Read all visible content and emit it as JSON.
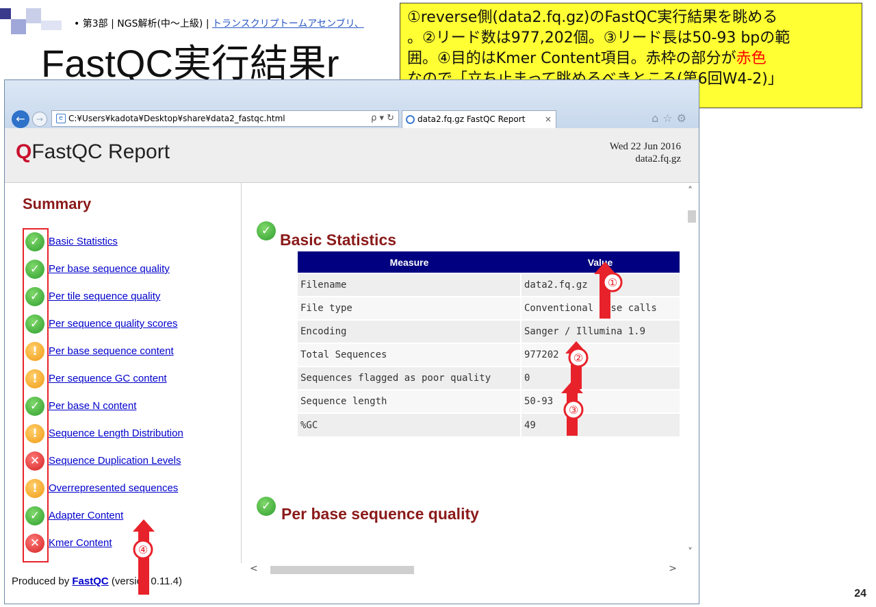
{
  "slide": {
    "bullet_section": "第3部 | NGS解析(中～上級) | ",
    "bullet_link": "トランスクリプトームアセンブリ、",
    "title": "FastQC実行結果r",
    "page_number": "24"
  },
  "callout": {
    "line1": "①reverse側(data2.fq.gz)のFastQC実行結果を眺める",
    "line2": "。②リード数は977,202個。③リード長は50-93 bpの範",
    "line3_a": "囲。④目的はKmer Content項目。赤枠の部分が",
    "line3_red": "赤色",
    "line4": "なので「立ち止まって眺めるべきところ(第6回W4-2)」"
  },
  "browser": {
    "address": "C:¥Users¥kadota¥Desktop¥share¥data2_fastqc.html",
    "address_tools": "ρ ▾ ↻",
    "tab_label": "data2.fq.gz FastQC Report",
    "tab_close": "×",
    "win_icons": "⌂☆⚙"
  },
  "report": {
    "logo_q": "Q",
    "logo_text": "FastQC Report",
    "date": "Wed 22 Jun 2016",
    "filename": "data2.fq.gz",
    "summary_title": "Summary",
    "modules": [
      {
        "label": "Basic Statistics",
        "status": "pass"
      },
      {
        "label": "Per base sequence quality",
        "status": "pass"
      },
      {
        "label": "Per tile sequence quality",
        "status": "pass"
      },
      {
        "label": "Per sequence quality scores",
        "status": "pass"
      },
      {
        "label": "Per base sequence content",
        "status": "warn"
      },
      {
        "label": "Per sequence GC content",
        "status": "warn"
      },
      {
        "label": "Per base N content",
        "status": "pass"
      },
      {
        "label": "Sequence Length Distribution",
        "status": "warn"
      },
      {
        "label": "Sequence Duplication Levels",
        "status": "fail"
      },
      {
        "label": "Overrepresented sequences",
        "status": "warn"
      },
      {
        "label": "Adapter Content",
        "status": "pass"
      },
      {
        "label": "Kmer Content",
        "status": "fail"
      }
    ],
    "basic_stats_title": "Basic Statistics",
    "table_headers": [
      "Measure",
      "Value"
    ],
    "rows": [
      {
        "measure": "Filename",
        "value": "data2.fq.gz"
      },
      {
        "measure": "File type",
        "value": "Conventional base calls"
      },
      {
        "measure": "Encoding",
        "value": "Sanger / Illumina 1.9"
      },
      {
        "measure": "Total Sequences",
        "value": "977202"
      },
      {
        "measure": "Sequences flagged as poor quality",
        "value": "0"
      },
      {
        "measure": "Sequence length",
        "value": "50-93"
      },
      {
        "measure": "%GC",
        "value": "49"
      }
    ],
    "next_section_title": "Per base sequence quality",
    "footer_prefix": "Produced by ",
    "footer_link": "FastQC",
    "footer_suffix": " (version 0.11.4)"
  },
  "markers": [
    "①",
    "②",
    "③",
    "④"
  ],
  "colors": {
    "callout_bg": "#ffff33",
    "marker_red": "#e8222a",
    "table_header": "#000080",
    "section_title": "#8b1a1a"
  }
}
